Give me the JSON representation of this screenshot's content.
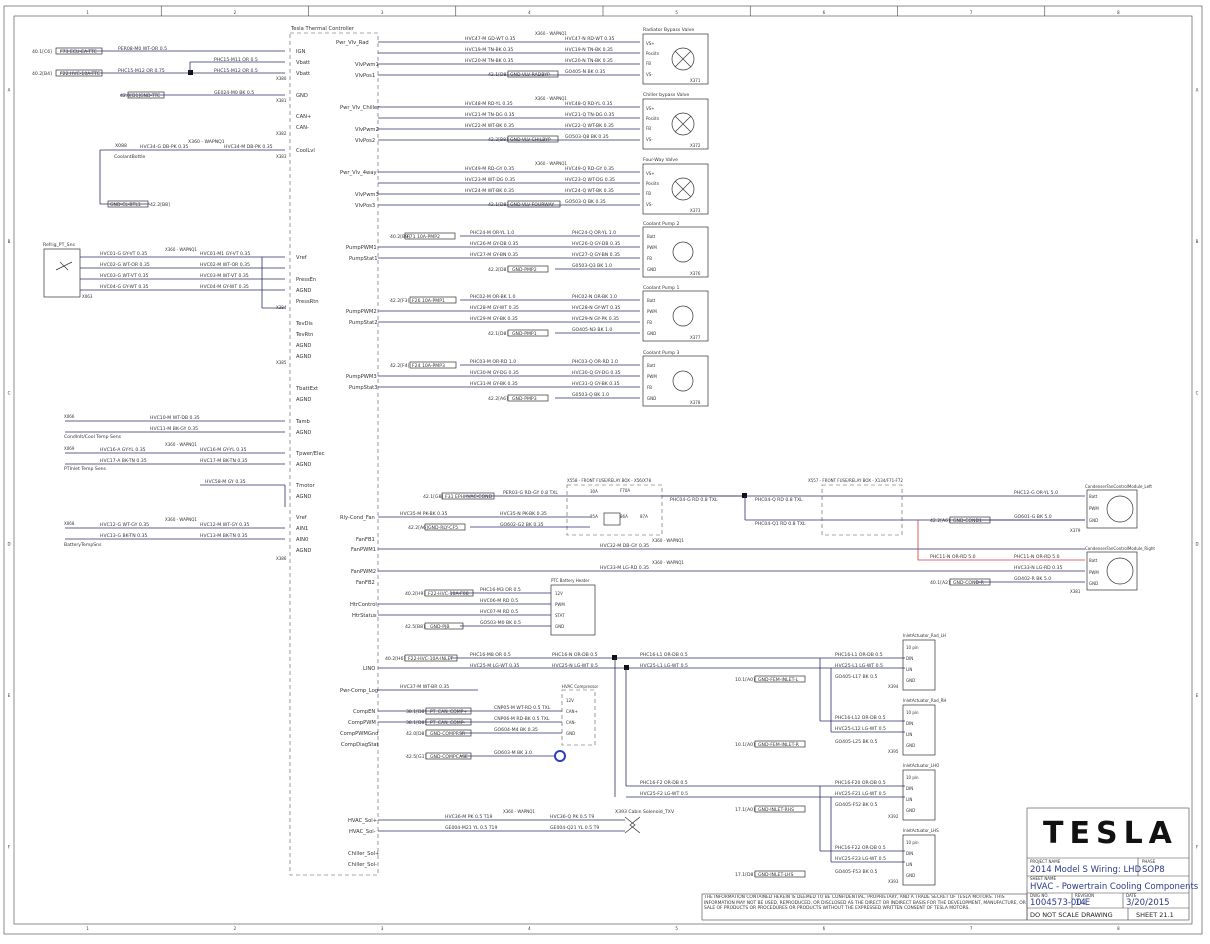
{
  "frame": {
    "columns": [
      "1",
      "2",
      "3",
      "4",
      "5",
      "6",
      "7",
      "8"
    ],
    "rows": [
      "A",
      "B",
      "C",
      "D",
      "E",
      "F"
    ]
  },
  "controller": {
    "title": "Tesla Thermal Controller",
    "pins_power": [
      "IGN",
      "Vbatt",
      "Vbatt",
      "GND"
    ],
    "can": [
      "CAN+",
      "CAN-"
    ],
    "cool_lvl": "CoolLvl",
    "connectors": [
      "X380",
      "X381",
      "X382",
      "X383",
      "X384",
      "X385",
      "X386"
    ]
  },
  "sensors": {
    "refrig": "Refrig_PT_Sns",
    "coolant_bottle": "CoolantBottle",
    "cond_sw": "CondInlt/Cool Temp Sens",
    "ptinlet": "PTInlet Temp Sens",
    "battery": "BatteryTempSns"
  },
  "valves": [
    {
      "name": "Radiator Bypass Valve",
      "conn": "X371",
      "signal": "Pwr_Vlv_Rad",
      "pins": [
        "VS+",
        "Posiitn",
        "FB",
        "VS-"
      ]
    },
    {
      "name": "Chiller bypass Valve",
      "conn": "X372",
      "signal": "Pwr_Vlv_Chiller",
      "pins": [
        "VS+",
        "Posiitn",
        "FB",
        "VS-"
      ]
    },
    {
      "name": "Four-Way Valve",
      "conn": "X373",
      "signal": "Pwr_Vlv_4way",
      "pins": [
        "VS+",
        "Posiitn",
        "FB",
        "VS-"
      ]
    }
  ],
  "pumps": [
    {
      "name": "Coolant Pump 2",
      "conn": "X376",
      "pins": [
        "Batt",
        "PWM",
        "FB",
        "GND"
      ]
    },
    {
      "name": "Coolant Pump 1",
      "conn": "X377",
      "pins": [
        "Batt",
        "PWM",
        "FB",
        "GND"
      ]
    },
    {
      "name": "Coolant Pump 3",
      "conn": "X378",
      "pins": [
        "Batt",
        "PWM",
        "FB",
        "GND"
      ]
    }
  ],
  "fans": [
    {
      "name": "CondenserFanControlModule_Left",
      "conn": "X379",
      "pins": [
        "Batt",
        "PWM",
        "GND"
      ]
    },
    {
      "name": "CondenserFanControlModule_Right",
      "conn": "X381",
      "pins": [
        "Batt",
        "PWM",
        "GND"
      ]
    }
  ],
  "fuse_box_front": "X558 - FRONT FUSE/RELAY BOX - X56/X78",
  "fuse_box_front2": "X557 - FRONT FUSE/RELAY BOX - X134/F71-F72",
  "relay_labels": [
    "30A",
    "F70A",
    "85A",
    "86A",
    "87A",
    "86"
  ],
  "heater": {
    "name": "PTC Battery Heater",
    "pins": [
      "12V",
      "PWM",
      "STAT",
      "GND"
    ]
  },
  "compressor": {
    "name": "HVAC Compressor",
    "pins": [
      "12V",
      "CAN+",
      "CAN-",
      "GND"
    ]
  },
  "actuators": [
    {
      "name": "InletActuator_Rad_LH",
      "conn": "X394",
      "pins": [
        "10 pin",
        "DIN",
        "LIN",
        "GND"
      ]
    },
    {
      "name": "InletActuator_Rad_RH",
      "conn": "X395",
      "pins": [
        "10 pin",
        "DIN",
        "LIN",
        "GND"
      ]
    },
    {
      "name": "InletActuator_LHO",
      "conn": "X392",
      "pins": [
        "10 pin",
        "DIN",
        "LIN",
        "GND"
      ]
    },
    {
      "name": "InletActuator_LHS",
      "conn": "X393",
      "pins": [
        "10 pin",
        "DIN",
        "LIN",
        "GND"
      ]
    }
  ],
  "solenoid": "X393 Cabin Solenoid_TXV",
  "left_signals": [
    "Pwr_Vlv_Rad",
    "VlvPwm1",
    "VlvPos1",
    "Pwr_Vlv_Chiller",
    "VlvPwm2",
    "VlvPos2",
    "Pwr_Vlv_4way",
    "VlvPwm3",
    "VlvPos3",
    "PumpPWM1",
    "PumpStat1",
    "PumpPWM2",
    "PumpStat2",
    "PumpPWM3",
    "PumpStat3",
    "Rly-Cond_Fan",
    "FanFB1",
    "FanPWM1",
    "FanPWM2",
    "FanFB2",
    "HtrControl",
    "HtrStatus",
    "LINO",
    "Pwr-Comp_Log",
    "CompEN",
    "CompPWM",
    "CompPWMGnd",
    "CompDiagStat",
    "HVAC_Sol+",
    "HVAC_Sol-",
    "Chiller_Sol+",
    "Chiller_Sol-"
  ],
  "right_signals": [
    "Vref",
    "PressEn",
    "AGND",
    "PressRtn",
    "TevDis",
    "TevRtn",
    "AGND",
    "AGND",
    "TbattExt",
    "AGND",
    "Tamb",
    "AGND",
    "Tpwer/Elec",
    "AGND",
    "Tmotor",
    "AGND",
    "Vref",
    "AIN1",
    "AIN0",
    "AGND"
  ],
  "notice": "THE INFORMATION CONTAINED HEREIN IS DEEMED TO BE CONFIDENTIAL, PROPRIETARY, AND A TRADE SECRET OF TESLA MOTORS. THIS INFORMATION MAY NOT BE USED, REPRODUCED, OR DISCLOSED AS THE DIRECT OR INDIRECT BASIS FOR THE DEVELOPMENT, MANUFACTURE, OR SALE OF PRODUCTS OR PROCEDURES OR PRODUCTS WITHOUT THE EXPRESSED WRITTEN CONSENT OF TESLA MOTORS.",
  "title_block": {
    "logo": "TESLA",
    "project_label": "PROJECT NAME",
    "project": "2014 Model S Wiring: LHD",
    "phase_label": "PHASE",
    "phase": "SOP8",
    "sheet_name_label": "SHEET NAME",
    "sheet_name": "HVAC - Powertrain Cooling Components",
    "dwg_label": "DWG NO.",
    "dwg": "1004573-00-E",
    "rev_label": "REVISION",
    "rev": "14",
    "date_label": "DATE",
    "date": "3/20/2015",
    "dns": "DO NOT SCALE DRAWING",
    "sheet": "SHEET 21.1"
  }
}
